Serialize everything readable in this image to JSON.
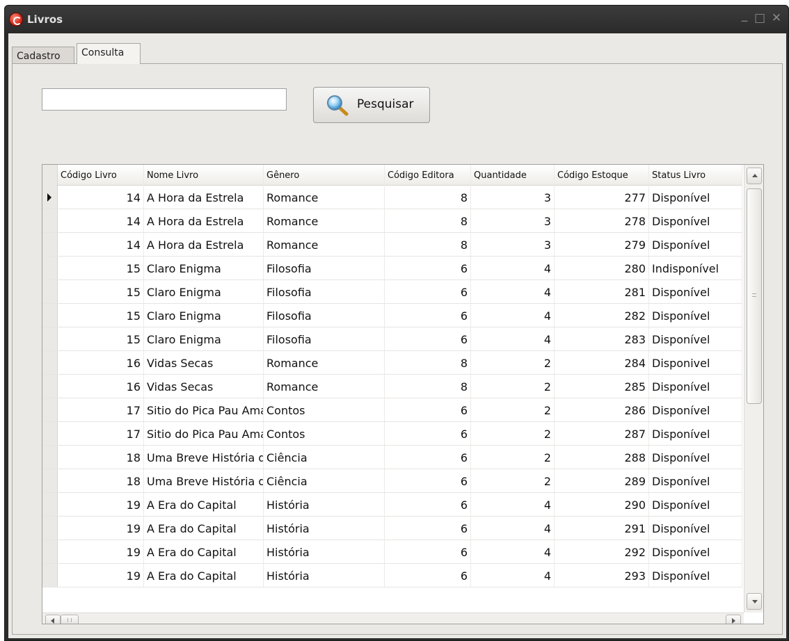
{
  "window": {
    "title": "Livros",
    "controls": {
      "minimize": "_",
      "maximize": "□",
      "close": "✕"
    }
  },
  "tabs": [
    {
      "label": "Cadastro",
      "active": false
    },
    {
      "label": "Consulta",
      "active": true
    }
  ],
  "search": {
    "value": "",
    "placeholder": "",
    "button_label": "Pesquisar",
    "button_icon": "magnifier-icon"
  },
  "grid": {
    "columns": [
      "Código Livro",
      "Nome Livro",
      "Gênero",
      "Código Editora",
      "Quantidade",
      "Código Estoque",
      "Status Livro"
    ],
    "selected_row": 0,
    "rows": [
      [
        "14",
        "A Hora da Estrela",
        "Romance",
        "8",
        "3",
        "277",
        "Disponível"
      ],
      [
        "14",
        "A Hora da Estrela",
        "Romance",
        "8",
        "3",
        "278",
        "Disponível"
      ],
      [
        "14",
        "A Hora da Estrela",
        "Romance",
        "8",
        "3",
        "279",
        "Disponível"
      ],
      [
        "15",
        "Claro Enigma",
        "Filosofia",
        "6",
        "4",
        "280",
        "Indisponível"
      ],
      [
        "15",
        "Claro Enigma",
        "Filosofia",
        "6",
        "4",
        "281",
        "Disponível"
      ],
      [
        "15",
        "Claro Enigma",
        "Filosofia",
        "6",
        "4",
        "282",
        "Disponível"
      ],
      [
        "15",
        "Claro Enigma",
        "Filosofia",
        "6",
        "4",
        "283",
        "Disponível"
      ],
      [
        "16",
        "Vidas Secas",
        "Romance",
        "8",
        "2",
        "284",
        "Disponivel"
      ],
      [
        "16",
        "Vidas Secas",
        "Romance",
        "8",
        "2",
        "285",
        "Disponível"
      ],
      [
        "17",
        "Sitio do Pica Pau Amarelo",
        "Contos",
        "6",
        "2",
        "286",
        "Disponível"
      ],
      [
        "17",
        "Sitio do Pica Pau Amarelo",
        "Contos",
        "6",
        "2",
        "287",
        "Disponível"
      ],
      [
        "18",
        "Uma Breve História do Tempo",
        "Ciência",
        "6",
        "2",
        "288",
        "Disponível"
      ],
      [
        "18",
        "Uma Breve História do Tempo",
        "Ciência",
        "6",
        "2",
        "289",
        "Disponível"
      ],
      [
        "19",
        "A Era do Capital",
        "História",
        "6",
        "4",
        "290",
        "Disponível"
      ],
      [
        "19",
        "A Era do Capital",
        "História",
        "6",
        "4",
        "291",
        "Disponível"
      ],
      [
        "19",
        "A Era do Capital",
        "História",
        "6",
        "4",
        "292",
        "Disponível"
      ],
      [
        "19",
        "A Era do Capital",
        "História",
        "6",
        "4",
        "293",
        "Disponível"
      ]
    ]
  },
  "colors": {
    "titlebar": "#2b2b2b",
    "surface": "#ebe9e5",
    "grid_background": "#ffffff",
    "app_icon": "#d42a1c"
  }
}
